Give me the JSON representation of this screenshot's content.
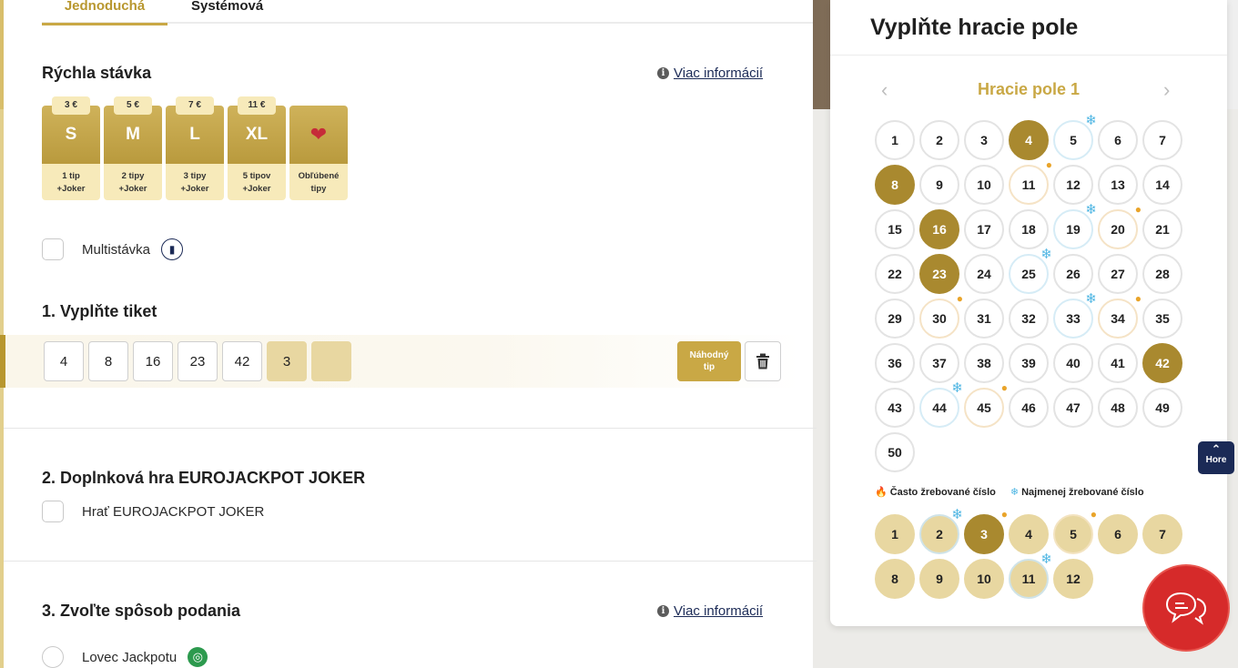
{
  "tabs": {
    "simple": "Jednoduchá",
    "system": "Systémová"
  },
  "quick_bet": {
    "title": "Rýchla stávka",
    "more_info": "Viac informácií",
    "options": [
      {
        "price": "3 €",
        "size": "S",
        "line1": "1 tip",
        "line2": "+Joker"
      },
      {
        "price": "5 €",
        "size": "M",
        "line1": "2 tipy",
        "line2": "+Joker"
      },
      {
        "price": "7 €",
        "size": "L",
        "line1": "3 tipy",
        "line2": "+Joker"
      },
      {
        "price": "11 €",
        "size": "XL",
        "line1": "5 tipov",
        "line2": "+Joker"
      }
    ],
    "favorite": {
      "line1": "Obľúbené",
      "line2": "tipy",
      "icon": "heart-icon"
    }
  },
  "multibet": {
    "label": "Multistávka",
    "icon": "multi-icon"
  },
  "ticket": {
    "title": "1. Vyplňte tiket",
    "main_numbers": [
      "4",
      "8",
      "16",
      "23",
      "42"
    ],
    "euro_numbers": [
      "3",
      ""
    ],
    "random_line1": "Náhodný",
    "random_line2": "tip"
  },
  "joker": {
    "title": "2. Doplnková hra EUROJACKPOT JOKER",
    "label": "Hrať EUROJACKPOT JOKER"
  },
  "submission": {
    "title": "3. Zvoľte spôsob podania",
    "more_info": "Viac informácií",
    "option": "Lovec Jackpotu"
  },
  "panel": {
    "title": "Vyplňte hracie pole",
    "field": "Hracie pole 1",
    "legend_hot": "Často žrebované číslo",
    "legend_cold": "Najmenej žrebované číslo"
  },
  "main_grid": {
    "numbers": [
      "1",
      "2",
      "3",
      "4",
      "5",
      "6",
      "7",
      "8",
      "9",
      "10",
      "11",
      "12",
      "13",
      "14",
      "15",
      "16",
      "17",
      "18",
      "19",
      "20",
      "21",
      "22",
      "23",
      "24",
      "25",
      "26",
      "27",
      "28",
      "29",
      "30",
      "31",
      "32",
      "33",
      "34",
      "35",
      "36",
      "37",
      "38",
      "39",
      "40",
      "41",
      "42",
      "43",
      "44",
      "45",
      "46",
      "47",
      "48",
      "49",
      "50"
    ],
    "selected": [
      4,
      8,
      16,
      23,
      42
    ],
    "cold": [
      5,
      19,
      25,
      33,
      44
    ],
    "hot": [
      11,
      20,
      30,
      34,
      45
    ]
  },
  "euro_grid": {
    "numbers": [
      "1",
      "2",
      "3",
      "4",
      "5",
      "6",
      "7",
      "8",
      "9",
      "10",
      "11",
      "12"
    ],
    "selected": [
      3
    ],
    "cold": [
      2,
      11
    ],
    "hot": [
      3,
      5
    ]
  },
  "scroll_top": "Hore",
  "colors": {
    "gold": "#c9a845",
    "dark_gold": "#a9892f",
    "navy": "#1b2a56",
    "chat_red": "#d62a2a"
  }
}
